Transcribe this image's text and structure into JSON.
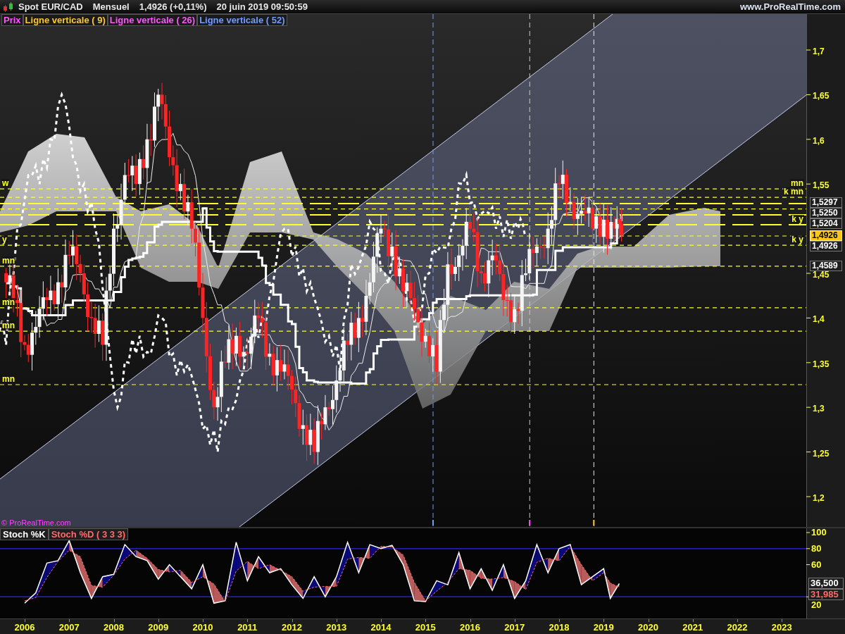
{
  "header": {
    "instrument": "Spot EUR/CAD",
    "period": "Mensuel",
    "quote": "1,4926 (+0,11%)",
    "datetime": "20 juin 2019 09:50:59",
    "site": "www.ProRealTime.com"
  },
  "legend": [
    {
      "label": "Prix",
      "color": "#ff55ff"
    },
    {
      "label": "Ligne verticale ( 9)",
      "color": "#ffc82a"
    },
    {
      "label": "Ligne verticale ( 26)",
      "color": "#ff55ff"
    },
    {
      "label": "Ligne verticale ( 52)",
      "color": "#6f9cff"
    }
  ],
  "price_chart": {
    "copyright": "© ProRealTime.com",
    "left_labels": [
      "w",
      "y",
      "mn",
      "mn",
      "mn",
      "mn"
    ],
    "right_labels": [
      "mn",
      "k mn",
      "k y",
      "k y"
    ],
    "axis_labels": [
      "1,7",
      "1,65",
      "1,6",
      "1,55",
      "1,45",
      "1,4",
      "1,35",
      "1,3",
      "1,25",
      "1,2"
    ],
    "price_tags": [
      {
        "text": "1,5297",
        "highlight": false
      },
      {
        "text": "1,5250",
        "highlight": false
      },
      {
        "text": "1,5204",
        "highlight": false
      },
      {
        "text": "1,4926",
        "highlight": true
      },
      {
        "text": "1,4926",
        "highlight": false
      },
      {
        "text": "1,4589",
        "highlight": false
      }
    ]
  },
  "stoch": {
    "labels": [
      {
        "label": "Stoch %K",
        "color": "#ffffff"
      },
      {
        "label": "Stoch %D ( 3 3 3)",
        "color": "#ff6a6a"
      }
    ],
    "axis_labels": [
      "100",
      "80",
      "60",
      "20"
    ],
    "value_tags": [
      {
        "text": "36,500",
        "color": "#ffffff"
      },
      {
        "text": "31,985",
        "color": "#ff6a6a"
      }
    ]
  },
  "time_axis": {
    "labels": [
      "2006",
      "2007",
      "2008",
      "2009",
      "2010",
      "2011",
      "2012",
      "2013",
      "2014",
      "2015",
      "2016",
      "2017",
      "2018",
      "2019",
      "2020",
      "2021",
      "2022",
      "2023"
    ]
  }
}
